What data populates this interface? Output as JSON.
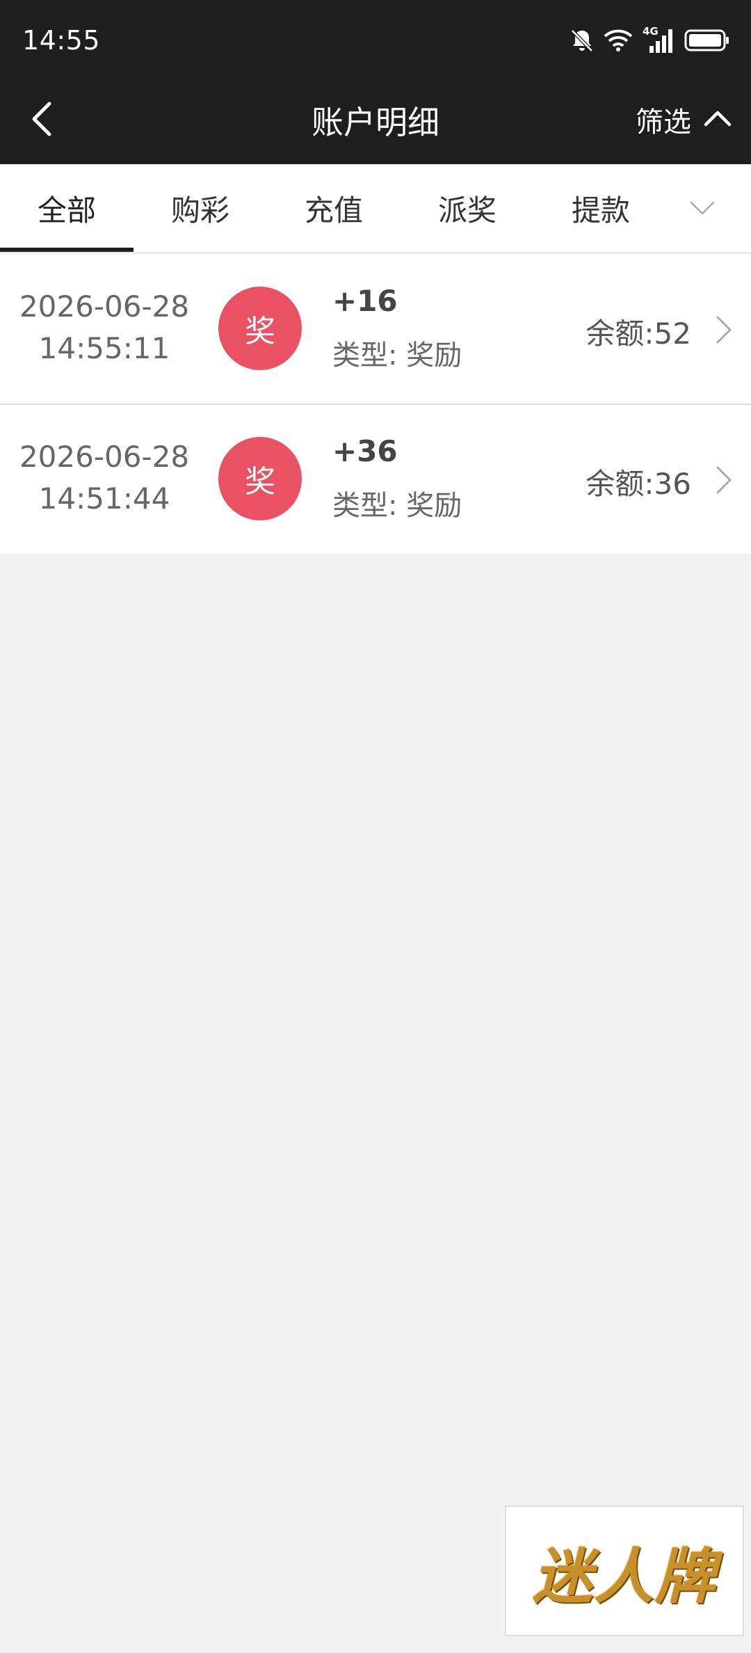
{
  "status_bar": {
    "time": "14:55",
    "icons": [
      "bell-muted-icon",
      "wifi-icon",
      "signal-4g-icon",
      "battery-icon"
    ],
    "network_label": "4G"
  },
  "header": {
    "title": "账户明细",
    "back_icon": "chevron-left-icon",
    "filter_label": "筛选",
    "filter_icon": "chevron-up-icon"
  },
  "tabs": {
    "items": [
      {
        "label": "全部",
        "active": true
      },
      {
        "label": "购彩",
        "active": false
      },
      {
        "label": "充值",
        "active": false
      },
      {
        "label": "派奖",
        "active": false
      },
      {
        "label": "提款",
        "active": false
      }
    ],
    "more_icon": "chevron-down-icon"
  },
  "records": [
    {
      "date": "2026-06-28",
      "time": "14:55:11",
      "badge": "奖",
      "amount": "+16",
      "type": "类型: 奖励",
      "balance": "余额:52"
    },
    {
      "date": "2026-06-28",
      "time": "14:51:44",
      "badge": "奖",
      "amount": "+36",
      "type": "类型: 奖励",
      "balance": "余额:36"
    }
  ],
  "watermark": {
    "text": "迷人牌"
  },
  "colors": {
    "header_bg": "#1e1e1e",
    "badge": "#ea5163",
    "page_bg": "#f3f3f3",
    "logo_gold": "#c8902a"
  }
}
